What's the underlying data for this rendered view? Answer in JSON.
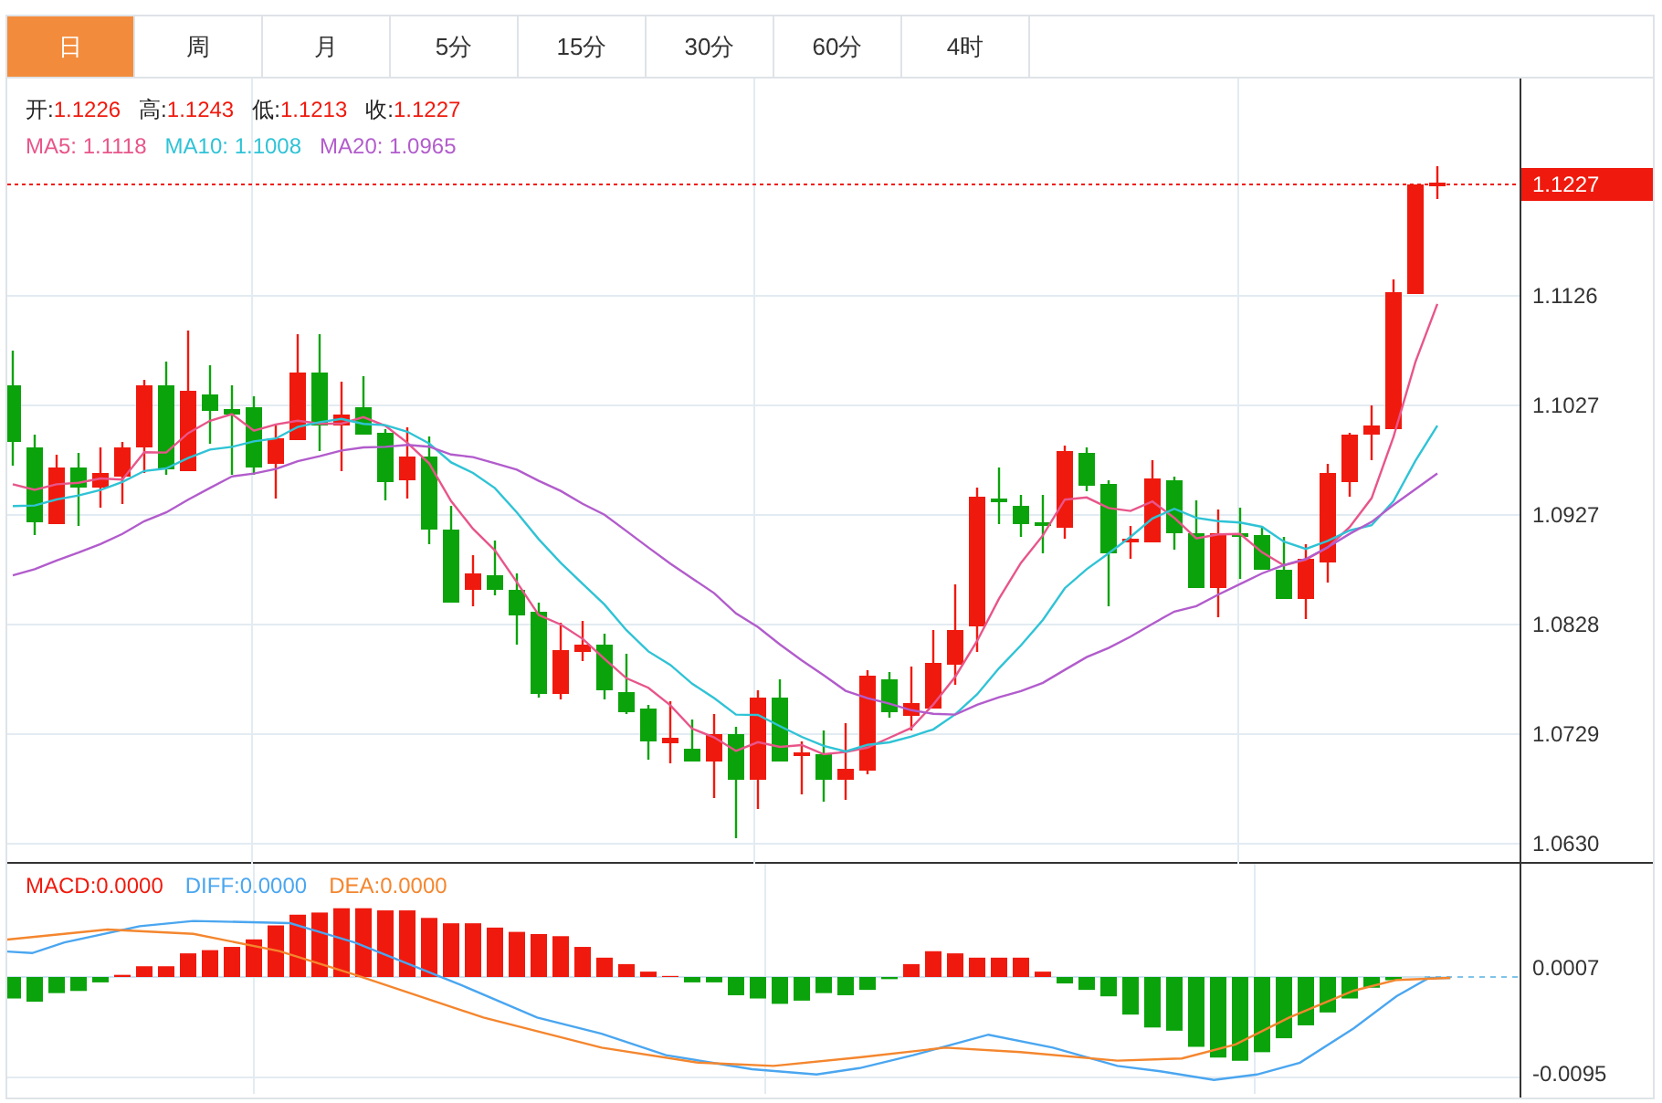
{
  "tabs": [
    {
      "label": "日",
      "selected": true
    },
    {
      "label": "周",
      "selected": false
    },
    {
      "label": "月",
      "selected": false
    },
    {
      "label": "5分",
      "selected": false
    },
    {
      "label": "15分",
      "selected": false
    },
    {
      "label": "30分",
      "selected": false
    },
    {
      "label": "60分",
      "selected": false
    },
    {
      "label": "4时",
      "selected": false
    }
  ],
  "ohlc": [
    {
      "label": "开:",
      "value": "1.1226"
    },
    {
      "label": "高:",
      "value": "1.1243"
    },
    {
      "label": "低:",
      "value": "1.1213"
    },
    {
      "label": "收:",
      "value": "1.1227"
    }
  ],
  "ma_legend": [
    {
      "label": "MA5:",
      "value": "1.1118",
      "color": "#e8558a"
    },
    {
      "label": "MA10:",
      "value": "1.1008",
      "color": "#2fc3d6"
    },
    {
      "label": "MA20:",
      "value": "1.0965",
      "color": "#b25ccc"
    }
  ],
  "price_axis": {
    "current": "1.1227",
    "ticks": [
      "1.1126",
      "1.1027",
      "1.0927",
      "1.0828",
      "1.0729",
      "1.0630"
    ]
  },
  "macd_legend": [
    {
      "label": "MACD:",
      "value": "0.0000",
      "color": "#f0190d"
    },
    {
      "label": "DIFF:",
      "value": "0.0000",
      "color": "#4aa6f0"
    },
    {
      "label": "DEA:",
      "value": "0.0000",
      "color": "#f4862e"
    }
  ],
  "macd_axis": {
    "ticks": [
      "0.0007",
      "-0.0095"
    ]
  }
}
